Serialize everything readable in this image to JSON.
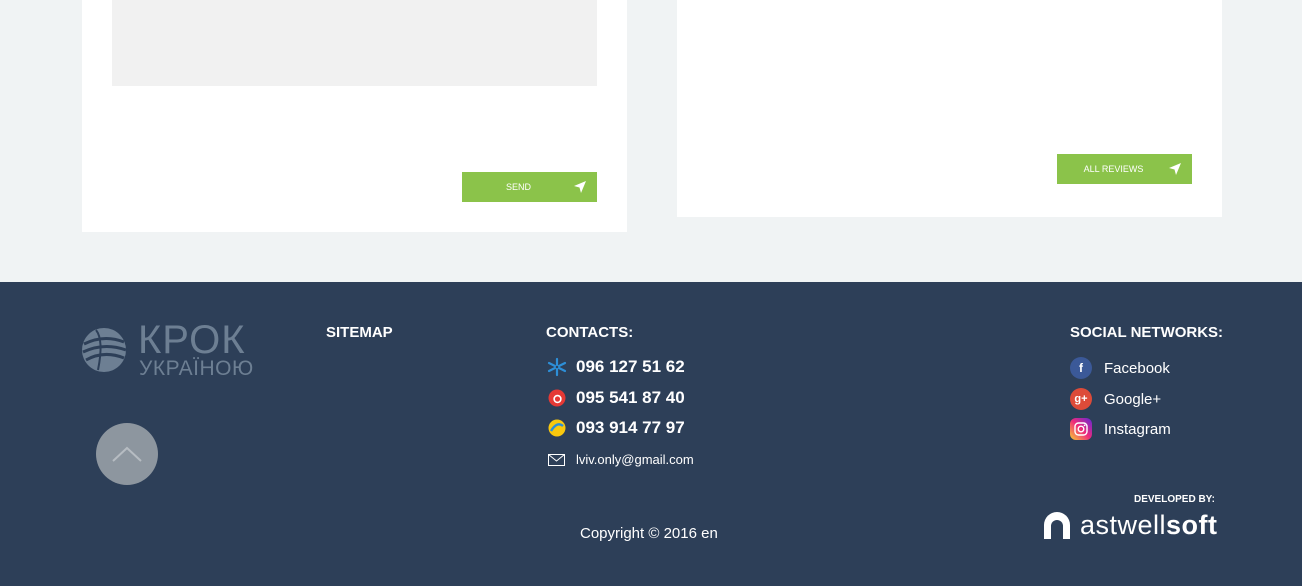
{
  "form": {
    "send_label": "Send"
  },
  "reviews": {
    "all_reviews_label": "All reviews"
  },
  "footer": {
    "logo": {
      "title": "КРОК",
      "subtitle": "УКРАЇНОЮ"
    },
    "sitemap_heading": "Sitemap",
    "contacts_heading": "Contacts:",
    "phones": [
      {
        "operator_icon": "kyivstar-icon",
        "number": "096 127 51 62",
        "color": "#2d8fd8"
      },
      {
        "operator_icon": "vodafone-icon",
        "number": "095 541 87 40",
        "color": "#e53935"
      },
      {
        "operator_icon": "lifecell-icon",
        "number": "093 914 77 97",
        "color": "#f9c80e"
      }
    ],
    "email": "lviv.only@gmail.com",
    "social_heading": "Social networks:",
    "social": [
      {
        "icon": "facebook-icon",
        "label": "Facebook",
        "color": "#3b5998",
        "glyph": "f"
      },
      {
        "icon": "google-plus-icon",
        "label": "Google+",
        "color": "#dd4b39",
        "glyph": "g+"
      },
      {
        "icon": "instagram-icon",
        "label": "Instagram",
        "color": "#c13584",
        "glyph": ""
      }
    ],
    "copyright": "Copyright © 2016 en",
    "developed_by": "DEVELOPED BY:",
    "developer": {
      "light": "astwell",
      "bold": "soft"
    }
  },
  "colors": {
    "footer_bg": "#2d3f58",
    "accent_green": "#8bc34a",
    "page_bg": "#f0f3f4"
  }
}
